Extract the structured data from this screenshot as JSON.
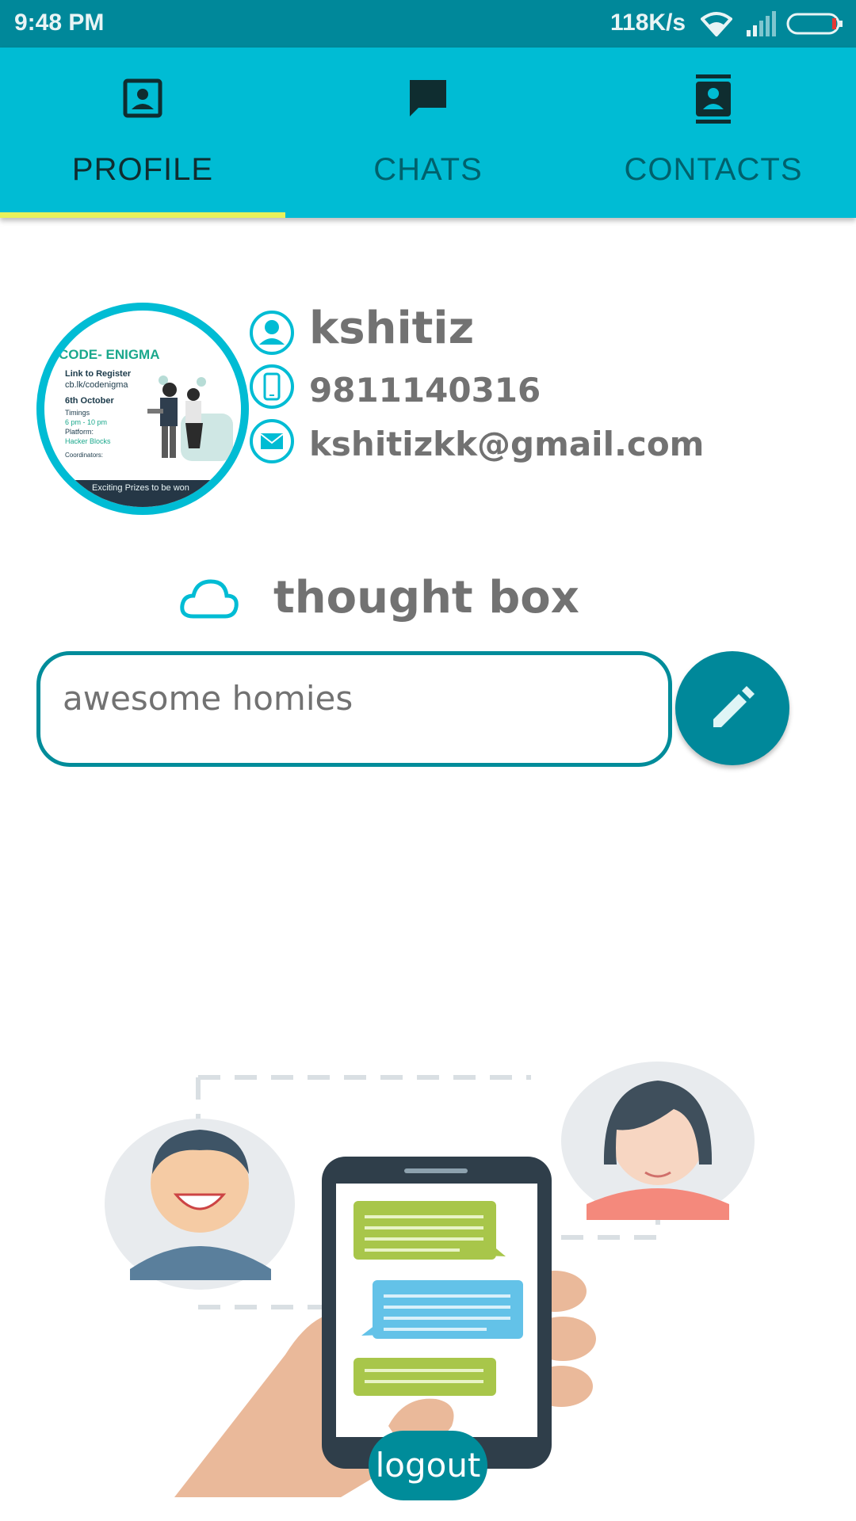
{
  "status_bar": {
    "time": "9:48 PM",
    "network_speed": "118K/s",
    "icons": [
      "wifi-icon",
      "signal-icon",
      "battery-icon"
    ]
  },
  "tabs": [
    {
      "label": "PROFILE",
      "icon": "profile-icon",
      "active": true
    },
    {
      "label": "CHATS",
      "icon": "chat-icon",
      "active": false
    },
    {
      "label": "CONTACTS",
      "icon": "contacts-icon",
      "active": false
    }
  ],
  "profile": {
    "name": "kshitiz",
    "phone": "9811140316",
    "email": "kshitizkk@gmail.com",
    "avatar_poster": {
      "title": "CODE- ENIGMA",
      "lines": [
        "Link to Register",
        "cb.lk/codenigma",
        "6th October",
        "Timings",
        "6 pm - 10 pm",
        "Platform:",
        "Hacker Blocks",
        "Coordinators:"
      ],
      "footer": "Exciting Prizes to be won"
    }
  },
  "thought_box": {
    "title": "thought box",
    "value": "awesome homies"
  },
  "logout_label": "logout",
  "colors": {
    "status_bar": "#00889a",
    "tab_bar": "#00bcd4",
    "indicator": "#e8f15a",
    "accent_dark": "#008c9a",
    "text_gray": "#727272"
  }
}
